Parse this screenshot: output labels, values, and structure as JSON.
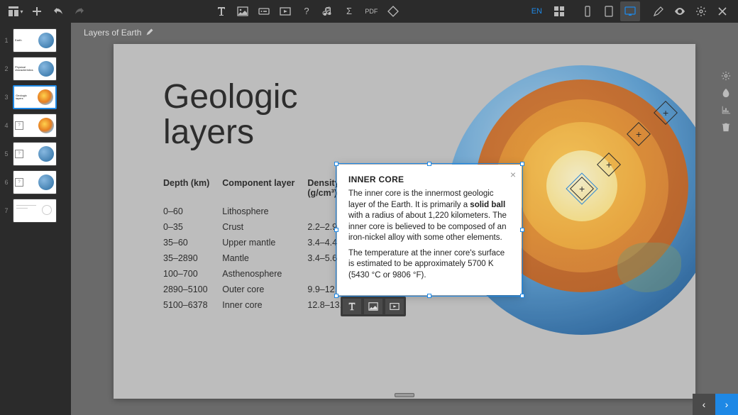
{
  "header": {
    "title": "Layers of Earth",
    "lang": "EN",
    "pdf_label": "PDF"
  },
  "slide": {
    "title_line1": "Geologic",
    "title_line2": "layers",
    "table": {
      "headers": {
        "depth": "Depth (km)",
        "component": "Component layer",
        "density": "Density (g/cm³)"
      },
      "rows": [
        {
          "depth": "0–60",
          "component": "Lithosphere",
          "density": ""
        },
        {
          "depth": "0–35",
          "component": "Crust",
          "density": "2.2–2.9"
        },
        {
          "depth": "35–60",
          "component": "Upper mantle",
          "density": "3.4–4.4"
        },
        {
          "depth": "35–2890",
          "component": "Mantle",
          "density": "3.4–5.6"
        },
        {
          "depth": "100–700",
          "component": "Asthenosphere",
          "density": ""
        },
        {
          "depth": "2890–5100",
          "component": "Outer core",
          "density": "9.9–12.2"
        },
        {
          "depth": "5100–6378",
          "component": "Inner core",
          "density": "12.8–13.1"
        }
      ]
    }
  },
  "popup": {
    "title": "INNER CORE",
    "p1a": "The inner core is the innermost geologic layer of the Earth. It is primarily a ",
    "p1b": "solid ball",
    "p1c": " with a radius of about 1,220 kilometers. The inner core is believed to be composed of an iron-nickel alloy with some other elements.",
    "p2": "The temperature at the inner core's surface is estimated to be approximately 5700 K (5430 °C or 9806 °F)."
  },
  "thumbs": [
    {
      "n": "1",
      "title": "Earth",
      "kind": "blue"
    },
    {
      "n": "2",
      "title": "Physical characteristics",
      "kind": "blue"
    },
    {
      "n": "3",
      "title": "Geologic layers",
      "kind": "orange"
    },
    {
      "n": "4",
      "title": "?",
      "kind": "orange-q"
    },
    {
      "n": "5",
      "title": "?",
      "kind": "blue-q"
    },
    {
      "n": "6",
      "title": "?",
      "kind": "blue-q"
    },
    {
      "n": "7",
      "title": "",
      "kind": "blank"
    }
  ],
  "icons": {
    "layout": "layout-icon",
    "plus": "plus-icon",
    "undo": "undo-icon",
    "redo": "redo-icon",
    "text": "text-icon",
    "image": "image-icon",
    "button": "button-icon",
    "video": "video-icon",
    "question": "question-icon",
    "music": "music-icon",
    "sigma": "sigma-icon",
    "shape": "shape-icon",
    "grid": "grid-icon",
    "phone": "phone-icon",
    "tablet": "tablet-icon",
    "desktop": "desktop-icon",
    "pen": "pen-icon",
    "eye": "eye-icon",
    "gear": "gear-icon",
    "close": "close-icon",
    "edit": "edit-icon",
    "drop": "drop-icon",
    "chart": "chart-icon",
    "trash": "trash-icon"
  }
}
